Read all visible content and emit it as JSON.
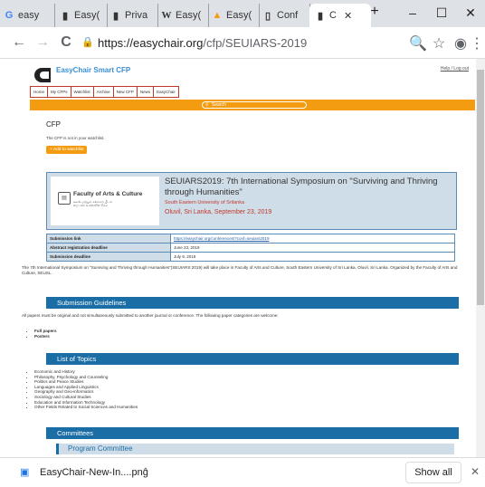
{
  "browser": {
    "tabs": [
      {
        "icon": "google-icon",
        "label": "easy"
      },
      {
        "icon": "easychair-icon",
        "label": "Easy("
      },
      {
        "icon": "easychair-icon",
        "label": "Priva"
      },
      {
        "icon": "wikipedia-icon",
        "label": "Easy("
      },
      {
        "icon": "orange-icon",
        "label": "Easy("
      },
      {
        "icon": "doc-icon",
        "label": "Conf"
      },
      {
        "icon": "easychair-icon",
        "label": "C"
      }
    ],
    "new_tab": "+",
    "url_host": "https://easychair.org",
    "url_path": "/cfp/SEUIARS-2019",
    "controls": {
      "minimize": "–",
      "maximize": "☐",
      "close": "✕"
    },
    "nav": {
      "back": "←",
      "forward": "→",
      "reload": "C"
    }
  },
  "page": {
    "site_name": "EasyChair Smart CFP",
    "help_link": "Help / Log out",
    "menu": [
      "Home",
      "My CFPs",
      "Watchlist",
      "Archive",
      "New CFP",
      "News",
      "EasyChair"
    ],
    "search_placeholder": "Search",
    "cfp_title": "CFP",
    "not_in_watchlist": "The CFP is not in your watchlist.",
    "add_watchlist": "+ Add to watchlist",
    "faculty": {
      "name": "Faculty of Arts & Culture",
      "sub1": "கலை மற்றும் கலாசார பீடம்",
      "sub2": "කලා සහ සංස්කෘතික පීඨය"
    },
    "conference": {
      "title": "SEUIARS2019: 7th International Symposium on \"Surviving and Thriving through Humanities\"",
      "university": "South Eastern University of Srilanka",
      "location": "Oluvil, Sri Lanka, September 23, 2019"
    },
    "info": [
      {
        "key": "Submission link",
        "value": "https://easychair.org/conferences/?conf=seuiars2019",
        "link": true
      },
      {
        "key": "Abstract registration deadline",
        "value": "June 23, 2019",
        "link": false
      },
      {
        "key": "Submission deadline",
        "value": "July 9, 2019",
        "link": false
      }
    ],
    "intro": "The 7th International Symposium on \"Surviving and Thriving through Humanities\"(SEUIARS 2019) will take place in Faculty of Arts and Culture, South Eastern University of Sri Lanka, Oluvil, Sri Lanka. Organized by the Faculty of Arts and Culture, SEUSL.",
    "submission_guidelines": {
      "heading": "Submission Guidelines",
      "text": "All papers must be original and not simultaneously submitted to another journal or conference. The following paper categories are welcome:",
      "items": [
        "Full papers",
        "Posters"
      ]
    },
    "topics": {
      "heading": "List of Topics",
      "items": [
        "Economic and History",
        "Philosophy, Psychology and Counseling",
        "Politics and Peace Studies",
        "Languages and Applied Linguistics",
        "Geography and Geo-informatics",
        "Sociology and Cultural Studies",
        "Education and Information Technology",
        "Other Fields Related to Social Sciences and Humanities"
      ]
    },
    "committees": {
      "heading": "Committees",
      "sub": "Program Committee"
    }
  },
  "download_bar": {
    "file": "EasyChair-New-In....png",
    "show_all": "Show all"
  }
}
